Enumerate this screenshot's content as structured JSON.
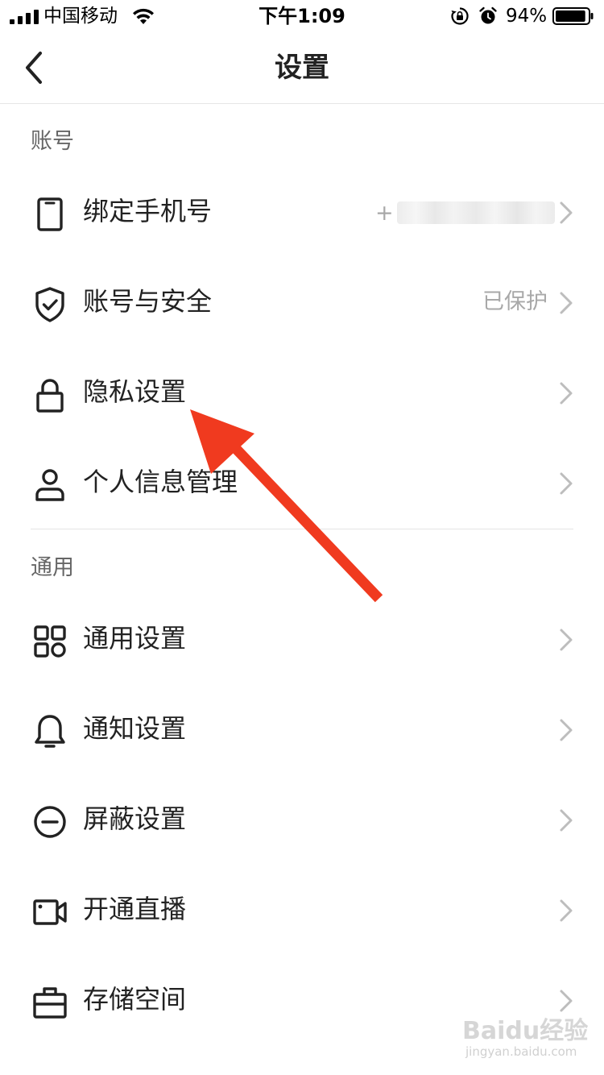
{
  "status_bar": {
    "carrier": "中国移动",
    "time": "下午1:09",
    "battery_percent": "94%",
    "battery_level": 0.94,
    "icons": [
      "signal-icon",
      "wifi-icon",
      "rotation-lock-icon",
      "alarm-icon",
      "battery-icon"
    ]
  },
  "nav": {
    "title": "设置",
    "back_icon": "chevron-left-icon"
  },
  "sections": [
    {
      "header": "账号",
      "items": [
        {
          "label": "绑定手机号",
          "value": "+",
          "icon": "phone-icon",
          "value_obscured": true
        },
        {
          "label": "账号与安全",
          "value": "已保护",
          "icon": "shield-check-icon"
        },
        {
          "label": "隐私设置",
          "value": "",
          "icon": "lock-icon"
        },
        {
          "label": "个人信息管理",
          "value": "",
          "icon": "user-icon"
        }
      ]
    },
    {
      "header": "通用",
      "items": [
        {
          "label": "通用设置",
          "value": "",
          "icon": "grid-icon"
        },
        {
          "label": "通知设置",
          "value": "",
          "icon": "bell-icon"
        },
        {
          "label": "屏蔽设置",
          "value": "",
          "icon": "block-icon"
        },
        {
          "label": "开通直播",
          "value": "",
          "icon": "video-camera-icon"
        },
        {
          "label": "存储空间",
          "value": "",
          "icon": "storage-box-icon"
        }
      ]
    }
  ],
  "annotation": {
    "type": "arrow",
    "color": "#f03a1f",
    "points_to": "隐私设置"
  },
  "watermark": {
    "main": "Baidu经验",
    "sub": "jingyan.baidu.com"
  },
  "colors": {
    "text": "#222222",
    "secondary": "#a8a8a8",
    "header": "#666666",
    "divider": "#e4e4e4",
    "arrow": "#f03a1f"
  }
}
